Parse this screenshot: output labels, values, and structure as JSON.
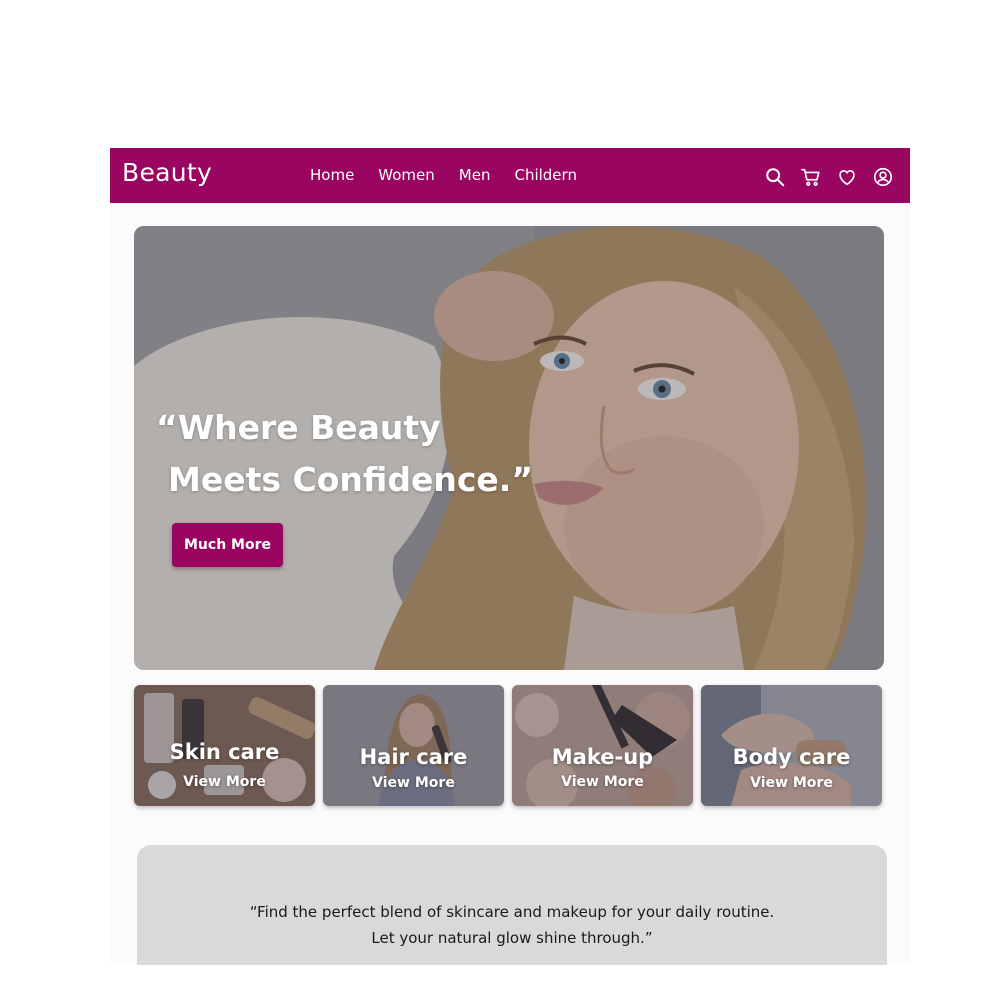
{
  "navbar": {
    "logo": "Beauty",
    "links": [
      "Home",
      "Women",
      "Men",
      "Childern"
    ],
    "icons": [
      "search-icon",
      "cart-icon",
      "heart-icon",
      "user-icon"
    ],
    "color": "#9a0561"
  },
  "hero": {
    "quote_line1": "“Where Beauty",
    "quote_line2": "Meets Confidence.”",
    "button_label": "Much More"
  },
  "categories": [
    {
      "title": "Skin care",
      "link": "View More"
    },
    {
      "title": "Hair care",
      "link": "View More"
    },
    {
      "title": "Make-up",
      "link": "View More"
    },
    {
      "title": "Body care",
      "link": "View More"
    }
  ],
  "tagline": {
    "line1": "“Find the perfect blend of skincare and makeup for your daily routine.",
    "line2": "Let your natural glow shine through.”"
  },
  "colors": {
    "accent": "#9a0561",
    "panel": "#d9d8db"
  }
}
